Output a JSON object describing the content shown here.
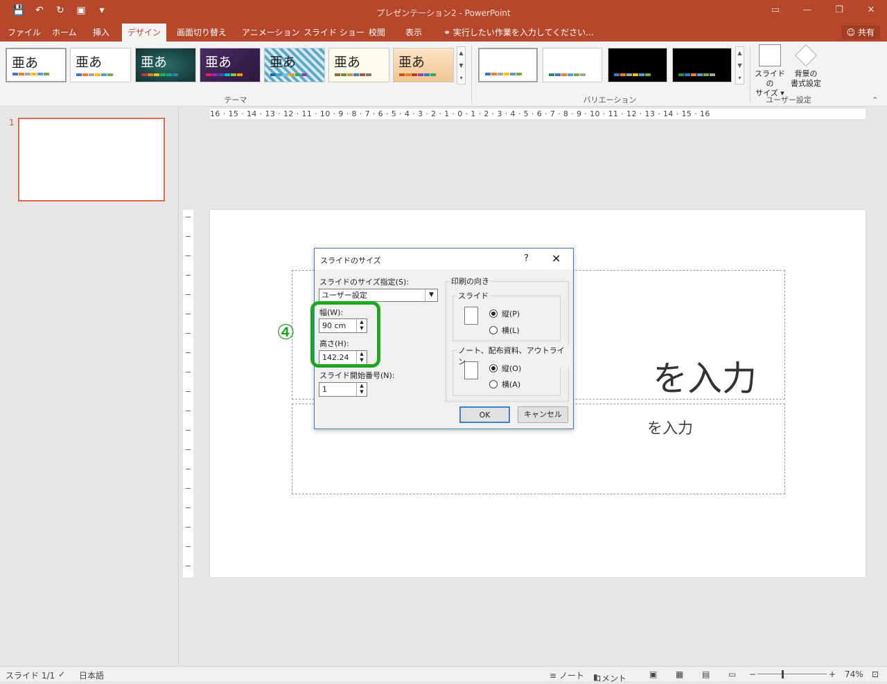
{
  "window": {
    "title": "プレゼンテーション2 - PowerPoint",
    "qat_icons": [
      "save-icon",
      "undo-icon",
      "redo-icon",
      "present-icon",
      "customize-icon"
    ],
    "controls": [
      "ribbon-display-icon",
      "minimize-icon",
      "restore-icon",
      "close-icon"
    ]
  },
  "tabs": [
    {
      "label": "ファイル"
    },
    {
      "label": "ホーム"
    },
    {
      "label": "挿入"
    },
    {
      "label": "デザイン",
      "active": true
    },
    {
      "label": "画面切り替え"
    },
    {
      "label": "アニメーション"
    },
    {
      "label": "スライド ショー"
    },
    {
      "label": "校閲"
    },
    {
      "label": "表示"
    },
    {
      "label": "実行したい作業を入力してください..."
    }
  ],
  "share_label": "共有",
  "ribbon": {
    "theme_sample": "亜あ",
    "group_themes": "テーマ",
    "group_variants": "バリエーション",
    "group_custom": "ユーザー設定",
    "slide_size_label": [
      "スライドの",
      "サイズ ▾"
    ],
    "background_label": [
      "背景の",
      "書式設定"
    ]
  },
  "thumbnail": {
    "number": "1"
  },
  "ruler_text": "16 · 15 · 14 · 13 · 12 · 11 · 10 · 9 · 8 · 7 · 6 · 5 · 4 · 3 · 2 · 1 · 0 · 1 · 2 · 3 · 4 · 5 · 6 · 7 · 8 · 9 · 10 · 11 · 12 · 13 · 14 · 15 · 16",
  "slide": {
    "title_fragment": "を入力",
    "subtitle_fragment": "を入力"
  },
  "annotation": {
    "marker": "④"
  },
  "dialog": {
    "title": "スライドのサイズ",
    "help": "?",
    "close": "✕",
    "size_label": "スライドのサイズ指定(S):",
    "size_value": "ユーザー設定",
    "width_label": "幅(W):",
    "width_value": "90 cm",
    "height_label": "高さ(H):",
    "height_value": "142.24",
    "start_label": "スライド開始番号(N):",
    "start_value": "1",
    "orientation_label": "印刷の向き",
    "slides_label": "スライド",
    "slides_portrait": "縦(P)",
    "slides_landscape": "横(L)",
    "notes_label": "ノート、配布資料、アウトライン",
    "notes_portrait": "縦(O)",
    "notes_landscape": "横(A)",
    "ok": "OK",
    "cancel": "キャンセル"
  },
  "status": {
    "slide": "スライド 1/1",
    "lang": "日本語",
    "notes": "≡ ノート",
    "comments": "コメント",
    "zoom": "74%"
  }
}
